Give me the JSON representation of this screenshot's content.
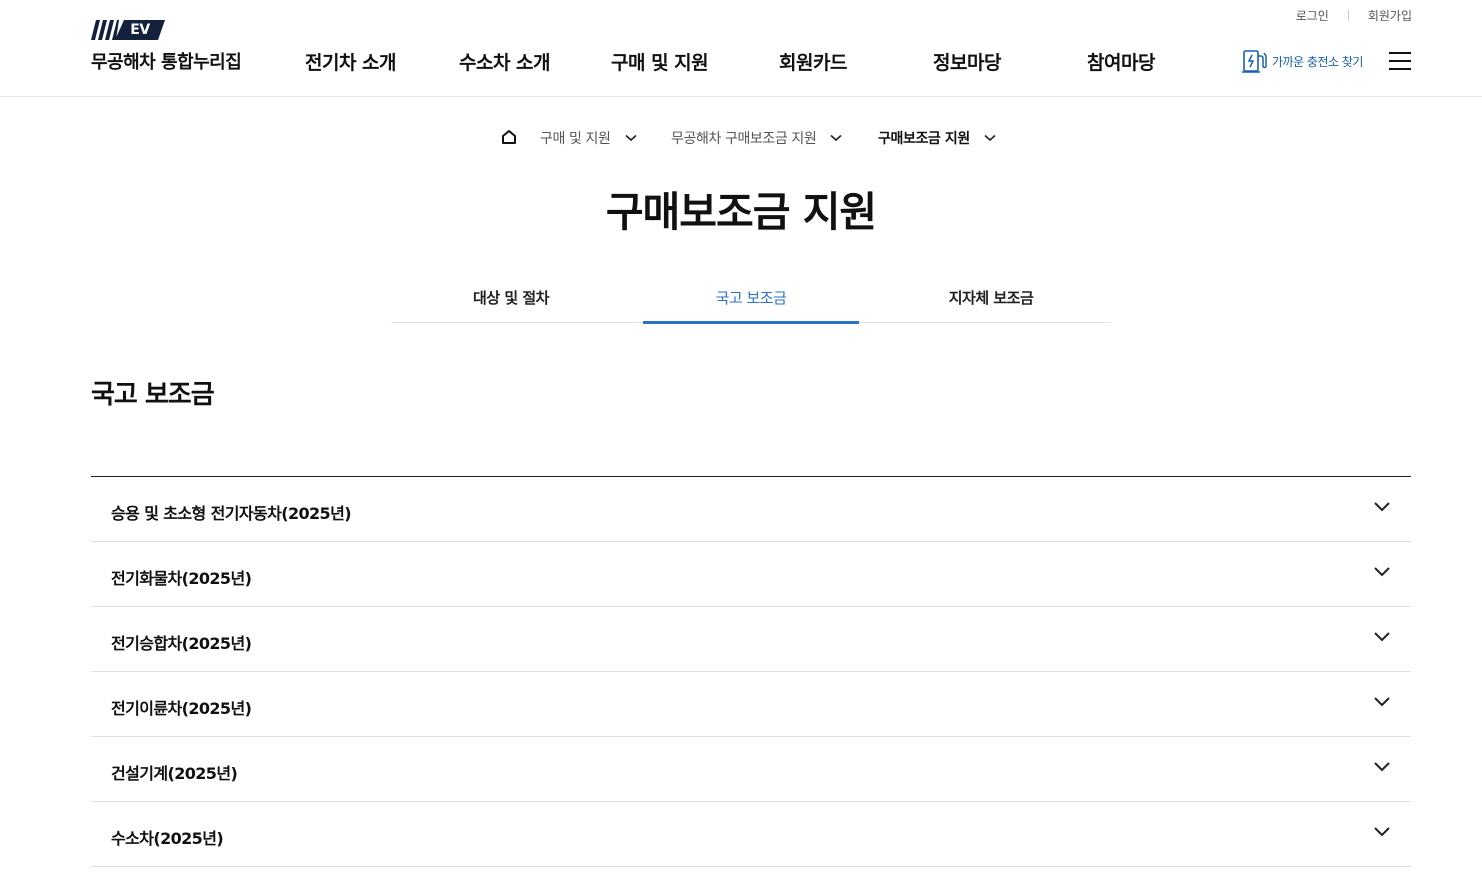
{
  "util": {
    "login": "로그인",
    "signup": "회원가입"
  },
  "logo": {
    "mark": "EV",
    "title": "무공해차 통합누리집"
  },
  "gnb": [
    "전기차 소개",
    "수소차 소개",
    "구매 및 지원",
    "회원카드",
    "정보마당",
    "참여마당"
  ],
  "charger": {
    "label": "가까운 충전소 찾기",
    "icon": "charger-icon"
  },
  "menu": {
    "icon": "hamburger-icon"
  },
  "breadcrumb": {
    "home_icon": "home-icon",
    "items": [
      "구매 및 지원",
      "무공해차 구매보조금 지원",
      "구매보조금 지원"
    ]
  },
  "page_title": "구매보조금 지원",
  "tabs": [
    {
      "label": "대상 및 절차",
      "active": false
    },
    {
      "label": "국고 보조금",
      "active": true
    },
    {
      "label": "지자체 보조금",
      "active": false
    }
  ],
  "section_title": "국고 보조금",
  "accordion": [
    "승용 및 초소형 전기자동차(2025년)",
    "전기화물차(2025년)",
    "전기승합차(2025년)",
    "전기이륜차(2025년)",
    "건설기계(2025년)",
    "수소차(2025년)"
  ],
  "colors": {
    "accent": "#2a72c8",
    "brand_navy": "#14213d",
    "link_blue": "#1a5fb4"
  }
}
